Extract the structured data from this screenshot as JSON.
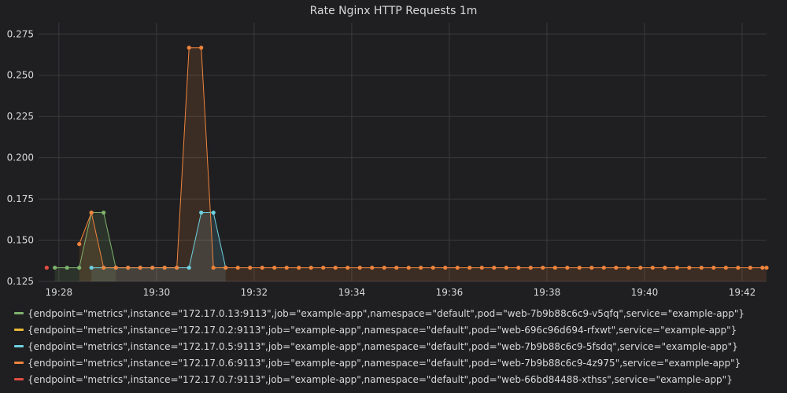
{
  "chart_data": {
    "type": "line",
    "title": "Rate Nginx HTTP Requests 1m",
    "xlabel": "",
    "ylabel": "",
    "ylim": [
      0.125,
      0.278
    ],
    "y_ticks": [
      "0.125",
      "0.150",
      "0.175",
      "0.200",
      "0.225",
      "0.250",
      "0.275"
    ],
    "x_ticks": [
      "19:28",
      "19:30",
      "19:32",
      "19:34",
      "19:36",
      "19:38",
      "19:40",
      "19:42"
    ],
    "x_range": [
      "19:27:35",
      "19:42:30"
    ],
    "grid": true,
    "legend_position": "bottom",
    "baseline": 0.1333,
    "series": [
      {
        "name": "{endpoint=\"metrics\",instance=\"172.17.0.13:9113\",job=\"example-app\",namespace=\"default\",pod=\"web-7b9b88c6c9-v5qfq\",service=\"example-app\"}",
        "color": "#7eb26d",
        "points": [
          [
            "19:27:55",
            0.1333
          ],
          [
            "19:28:10",
            0.1333
          ],
          [
            "19:28:25",
            0.1333
          ],
          [
            "19:28:40",
            0.1667
          ],
          [
            "19:28:55",
            0.1667
          ],
          [
            "19:29:10",
            0.1333
          ]
        ]
      },
      {
        "name": "{endpoint=\"metrics\",instance=\"172.17.0.2:9113\",job=\"example-app\",namespace=\"default\",pod=\"web-696c96d694-rfxwt\",service=\"example-app\"}",
        "color": "#eab839",
        "points": []
      },
      {
        "name": "{endpoint=\"metrics\",instance=\"172.17.0.5:9113\",job=\"example-app\",namespace=\"default\",pod=\"web-7b9b88c6c9-5fsdq\",service=\"example-app\"}",
        "color": "#6ed0e0",
        "points": [
          [
            "19:28:40",
            0.1333
          ],
          [
            "19:28:55",
            0.1333
          ],
          [
            "19:30:40",
            0.1333
          ],
          [
            "19:30:55",
            0.1667
          ],
          [
            "19:31:10",
            0.1667
          ],
          [
            "19:31:25",
            0.1333
          ]
        ]
      },
      {
        "name": "{endpoint=\"metrics\",instance=\"172.17.0.6:9113\",job=\"example-app\",namespace=\"default\",pod=\"web-7b9b88c6c9-4z975\",service=\"example-app\"}",
        "color": "#ef843c",
        "points": [
          [
            "19:28:25",
            0.1476
          ],
          [
            "19:28:40",
            0.1667
          ],
          [
            "19:28:55",
            0.1333
          ],
          [
            "19:30:25",
            0.1333
          ],
          [
            "19:30:40",
            0.2667
          ],
          [
            "19:30:55",
            0.2667
          ],
          [
            "19:31:10",
            0.1333
          ],
          [
            "19:42:30",
            0.1333
          ]
        ]
      },
      {
        "name": "{endpoint=\"metrics\",instance=\"172.17.0.7:9113\",job=\"example-app\",namespace=\"default\",pod=\"web-66bd84488-xthss\",service=\"example-app\"}",
        "color": "#e24d42",
        "points": [
          [
            "19:27:45",
            0.1333
          ]
        ]
      }
    ]
  }
}
